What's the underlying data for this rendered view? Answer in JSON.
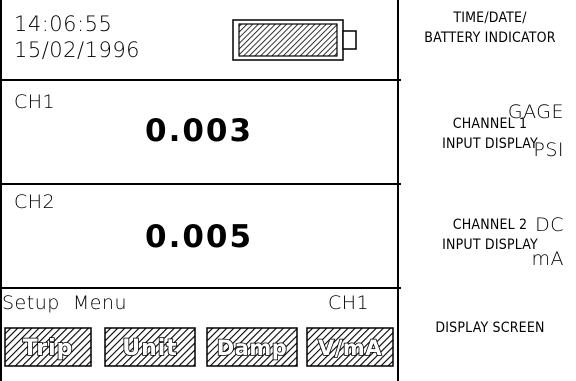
{
  "status": {
    "time": "14:06:55",
    "date": "15/02/1996"
  },
  "channel1": {
    "label": "CH1",
    "value": "0.003",
    "mode": "GAGE",
    "unit": "PSI"
  },
  "channel2": {
    "label": "CH2",
    "value": "0.005",
    "mode": "DC",
    "unit": "mA"
  },
  "menu": {
    "title": "Setup  Menu",
    "channel": "CH1",
    "softkeys": [
      "Trip",
      "Unit",
      "Damp",
      "V/mA"
    ]
  },
  "annotations": {
    "status": [
      "TIME/DATE/",
      "BATTERY INDICATOR"
    ],
    "channel1": [
      "CHANNEL 1",
      "INPUT DISPLAY"
    ],
    "channel2": [
      "CHANNEL 2",
      "INPUT DISPLAY"
    ],
    "screen": [
      "DISPLAY SCREEN"
    ]
  },
  "battery": {
    "charge_fraction": 1.0
  }
}
